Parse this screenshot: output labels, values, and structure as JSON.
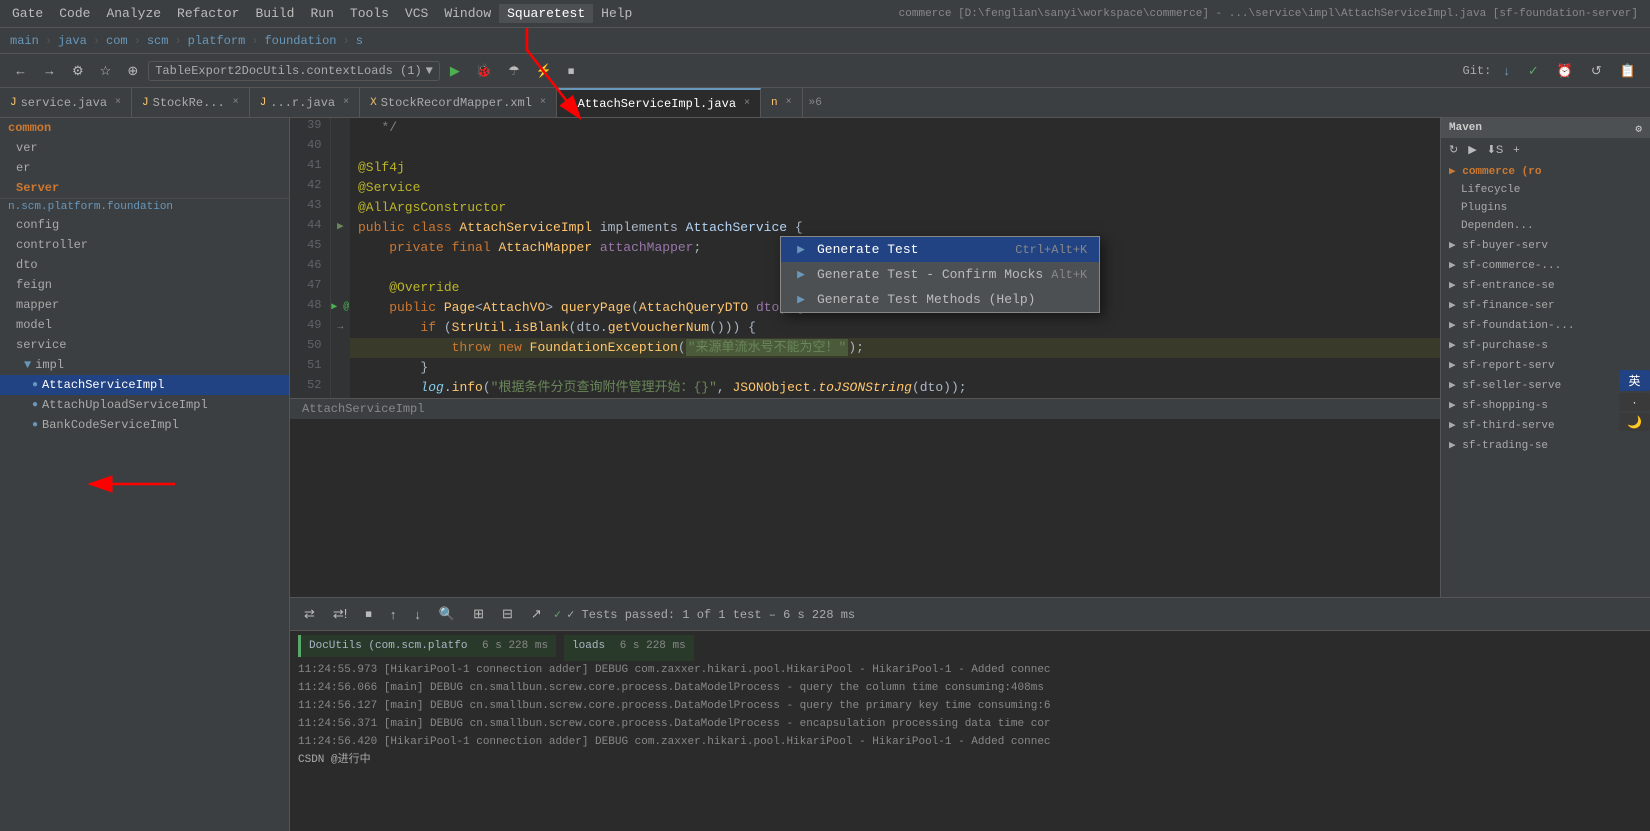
{
  "menubar": {
    "items": [
      "Gate",
      "Code",
      "Analyze",
      "Refactor",
      "Build",
      "Run",
      "Tools",
      "VCS",
      "Window",
      "Squaretest",
      "Help"
    ],
    "active_item": "Squaretest",
    "window_title": "commerce [D:\\fenglian\\sanyi\\workspace\\commerce] - ...\\service\\impl\\AttachServiceImpl.java [sf-foundation-server]"
  },
  "breadcrumb": {
    "items": [
      "main",
      "java",
      "com",
      "scm",
      "platform",
      "foundation",
      "s"
    ]
  },
  "tabs": [
    {
      "label": "service.java",
      "active": false,
      "icon": "J"
    },
    {
      "label": "StockRe...",
      "active": false,
      "icon": "J"
    },
    {
      "label": "...r.java",
      "active": false,
      "icon": "J"
    },
    {
      "label": "StockRecordMapper.xml",
      "active": false,
      "icon": "X"
    },
    {
      "label": "AttachServiceImpl.java",
      "active": true,
      "icon": "J"
    },
    {
      "label": "n",
      "active": false,
      "icon": "J"
    }
  ],
  "toolbar": {
    "run_combo": "TableExport2DocUtils.contextLoads (1)",
    "git_label": "Git:"
  },
  "sidebar": {
    "sections": [
      {
        "label": "common",
        "type": "group"
      },
      {
        "label": "ver",
        "type": "item"
      },
      {
        "label": "er",
        "type": "item"
      },
      {
        "label": "Server",
        "type": "item"
      },
      {
        "label": "n.scm.platform.foundation",
        "type": "divider"
      },
      {
        "label": "config",
        "type": "sub1"
      },
      {
        "label": "controller",
        "type": "sub1"
      },
      {
        "label": "dto",
        "type": "sub1"
      },
      {
        "label": "feign",
        "type": "sub1"
      },
      {
        "label": "mapper",
        "type": "sub1"
      },
      {
        "label": "model",
        "type": "sub1"
      },
      {
        "label": "service",
        "type": "sub1"
      },
      {
        "label": "impl",
        "type": "sub2"
      },
      {
        "label": "AttachServiceImpl",
        "type": "sub3",
        "selected": true,
        "has_icon": true
      },
      {
        "label": "AttachUploadServiceImpl",
        "type": "sub3",
        "has_icon": true
      },
      {
        "label": "BankCodeServiceImpl",
        "type": "sub3",
        "has_icon": true
      }
    ]
  },
  "code": {
    "lines": [
      {
        "num": 39,
        "content": "   */",
        "type": "comment"
      },
      {
        "num": 40,
        "content": ""
      },
      {
        "num": 41,
        "content": "@Slf4j",
        "type": "annotation"
      },
      {
        "num": 42,
        "content": "@Service",
        "type": "annotation"
      },
      {
        "num": 43,
        "content": "@AllArgsConstructor",
        "type": "annotation"
      },
      {
        "num": 44,
        "content": "public class AttachServiceImpl implements AttachService {",
        "type": "class_decl",
        "has_icon": true
      },
      {
        "num": 45,
        "content": "    private final AttachMapper attachMapper;",
        "type": "field"
      },
      {
        "num": 46,
        "content": ""
      },
      {
        "num": 47,
        "content": "    @Override",
        "type": "annotation"
      },
      {
        "num": 48,
        "content": "    public Page<AttachVO> queryPage(AttachQueryDTO dto) {",
        "type": "method",
        "has_icon": true
      },
      {
        "num": 49,
        "content": "        if (StrUtil.isBlank(dto.getVoucherNum())) {",
        "type": "if"
      },
      {
        "num": 50,
        "content": "            throw new FoundationException(\"来源单流水号不能为空！\");",
        "type": "throw",
        "highlighted": true
      },
      {
        "num": 51,
        "content": "        }",
        "type": "brace"
      },
      {
        "num": 52,
        "content": "        log.info(\"根据条件分页查询附件管理开始：{}\", JSONObject.toJSONString(dto));",
        "type": "log"
      }
    ],
    "breadcrumb_bottom": "AttachServiceImpl"
  },
  "dropdown": {
    "items": [
      {
        "label": "Generate Test",
        "shortcut": "Ctrl+Alt+K",
        "icon": "▶"
      },
      {
        "label": "Generate Test - Confirm Mocks",
        "shortcut": "Alt+K",
        "icon": "▶",
        "active": true
      },
      {
        "label": "Generate Test Methods (Help)",
        "shortcut": "",
        "icon": "▶"
      }
    ]
  },
  "right_panel": {
    "header": "Maven",
    "items": [
      {
        "label": "▶ commerce (ro",
        "active": true
      },
      {
        "label": "  Lifecycle",
        "indent": 1
      },
      {
        "label": "  Plugins",
        "indent": 1
      },
      {
        "label": "  Dependen...",
        "indent": 1
      },
      {
        "label": "▶ sf-buyer-serv",
        "indent": 0
      },
      {
        "label": "▶ sf-commerce-...",
        "indent": 0
      },
      {
        "label": "▶ sf-entrance-se",
        "indent": 0
      },
      {
        "label": "▶ sf-finance-ser",
        "indent": 0
      },
      {
        "label": "▶ sf-foundation-...",
        "indent": 0
      },
      {
        "label": "▶ sf-purchase-s",
        "indent": 0
      },
      {
        "label": "▶ sf-report-serv",
        "indent": 0
      },
      {
        "label": "▶ sf-seller-serve",
        "indent": 0
      },
      {
        "label": "▶ sf-shopping-s",
        "indent": 0
      },
      {
        "label": "▶ sf-third-serve",
        "indent": 0
      },
      {
        "label": "▶ sf-trading-se",
        "indent": 0
      }
    ]
  },
  "bottom_toolbar": {
    "test_result": "✓ Tests passed: 1 of 1 test – 6 s 228 ms",
    "test_item": "DocUtils (com.scm.platfo",
    "test_time": "6 s 228 ms",
    "test_item2": "loads",
    "test_time2": "6 s 228 ms"
  },
  "console": {
    "lines": [
      "11:24:55.973 [HikariPool-1 connection adder] DEBUG com.zaxxer.hikari.pool.HikariPool - HikariPool-1 - Added connec",
      "11:24:56.066 [main] DEBUG cn.smallbun.screw.core.process.DataModelProcess - query the column time consuming:408ms",
      "11:24:56.127 [main] DEBUG cn.smallbun.screw.core.process.DataModelProcess - query the primary key time consuming:6",
      "11:24:56.371 [main] DEBUG cn.smallbun.screw.core.process.DataModelProcess - encapsulation processing data time cor",
      "11:24:56.420 [HikariPool-1 connection adder] DEBUG com.zaxxer.hikari.pool.HikariPool - HikariPool-1 - Added connec",
      "CSDN @进行中"
    ]
  }
}
